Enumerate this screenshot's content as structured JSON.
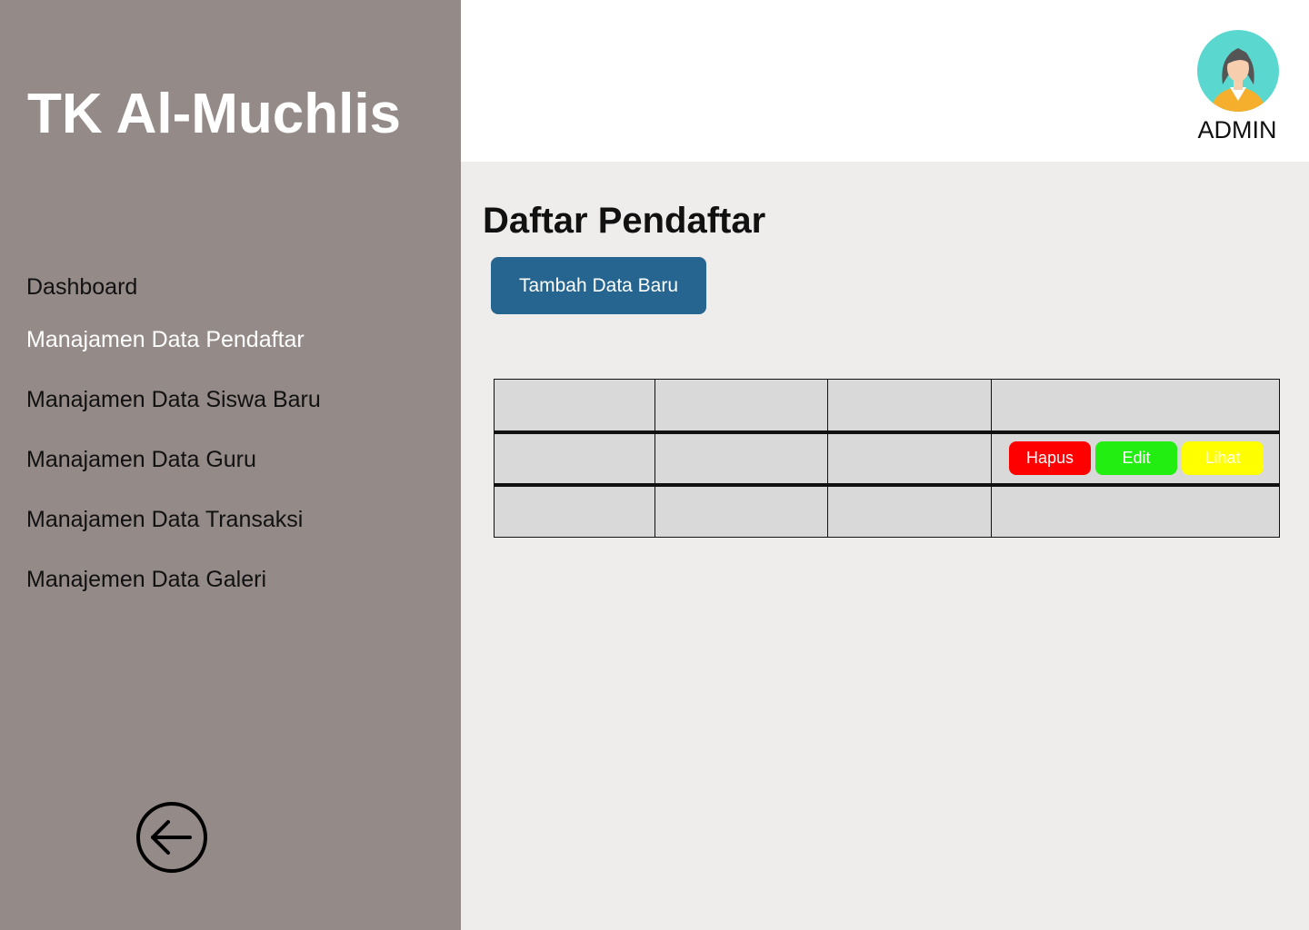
{
  "app": {
    "brand": "TK Al-Muchlis"
  },
  "sidebar": {
    "items": [
      {
        "label": "Dashboard",
        "active": false
      },
      {
        "label": "Manajamen Data Pendaftar",
        "active": true
      },
      {
        "label": "Manajamen Data Siswa Baru",
        "active": false
      },
      {
        "label": "Manajamen Data Guru",
        "active": false
      },
      {
        "label": "Manajamen Data Transaksi",
        "active": false
      },
      {
        "label": "Manajemen Data Galeri",
        "active": false
      }
    ],
    "back_icon": "arrow-left-circle-icon"
  },
  "header": {
    "user_label": "ADMIN",
    "avatar_icon": "female-avatar-icon"
  },
  "main": {
    "title": "Daftar Pendaftar",
    "add_button_label": "Tambah Data Baru",
    "row_actions": {
      "delete": "Hapus",
      "edit": "Edit",
      "view": "Lihat"
    }
  },
  "colors": {
    "sidebar_bg": "#948a88",
    "primary_button": "#256590",
    "delete": "#ff0000",
    "edit": "#22ee11",
    "view": "#ffff00",
    "table_cell": "#d9d9d9"
  }
}
